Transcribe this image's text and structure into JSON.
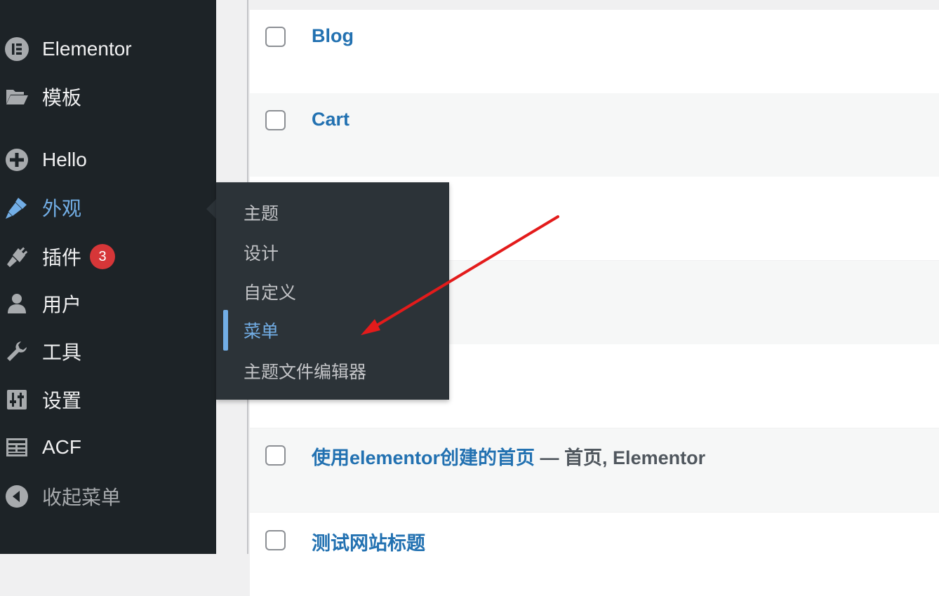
{
  "sidebar": {
    "items": [
      {
        "label": "Elementor",
        "icon": "elementor-icon"
      },
      {
        "label": "模板",
        "icon": "folder-open-icon"
      },
      {
        "label": "Hello",
        "icon": "plus-circle-icon"
      },
      {
        "label": "外观",
        "icon": "paintbrush-icon"
      },
      {
        "label": "插件",
        "icon": "plugin-icon",
        "badge": "3"
      },
      {
        "label": "用户",
        "icon": "user-icon"
      },
      {
        "label": "工具",
        "icon": "wrench-icon"
      },
      {
        "label": "设置",
        "icon": "settings-sliders-icon"
      },
      {
        "label": "ACF",
        "icon": "acf-grid-icon"
      },
      {
        "label": "收起菜单",
        "icon": "collapse-left-icon"
      }
    ],
    "active_label": "外观"
  },
  "flyout": {
    "items": [
      {
        "label": "主题"
      },
      {
        "label": "设计"
      },
      {
        "label": "自定义"
      },
      {
        "label": "菜单",
        "current": true
      },
      {
        "label": "主题文件编辑器"
      }
    ]
  },
  "pages": {
    "rows": [
      {
        "title": "Blog",
        "state": ""
      },
      {
        "title": "Cart",
        "state": ""
      },
      {
        "title": "",
        "state": ""
      },
      {
        "title": "",
        "state": ""
      },
      {
        "title": "",
        "state": ""
      },
      {
        "title": "使用elementor创建的首页",
        "state": " — 首页, Elementor"
      },
      {
        "title": "测试网站标题",
        "state": ""
      }
    ]
  },
  "colors": {
    "sidebar_bg": "#1d2327",
    "flyout_bg": "#2c3338",
    "accent": "#72aee6",
    "link": "#2271b1",
    "badge": "#d63638",
    "arrow": "#e31b1b"
  }
}
